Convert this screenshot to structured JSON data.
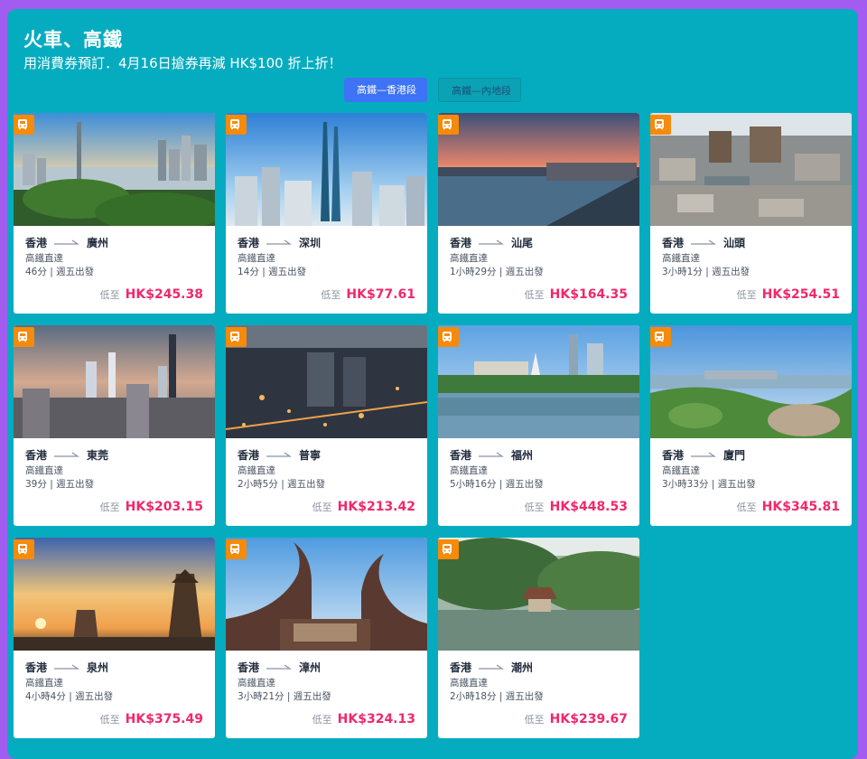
{
  "header": {
    "title": "火車、高鐵",
    "subtitle": "用消費券預訂．4月16日搶券再減 HK$100 折上折！"
  },
  "tabs": [
    {
      "label": "高鐵—香港段",
      "active": true
    },
    {
      "label": "高鐵—內地段",
      "active": false
    }
  ],
  "badge_icon": "train-icon",
  "colors": {
    "accent": "#3e73f5",
    "price": "#f0286d",
    "badge": "#f58a0b",
    "panel": "#05acbf"
  },
  "cards": [
    {
      "from": "香港",
      "to": "廣州",
      "type": "高鐵直達",
      "schedule": "46分 | 週五出發",
      "price_label": "低至",
      "price": "HK$245.38"
    },
    {
      "from": "香港",
      "to": "深圳",
      "type": "高鐵直達",
      "schedule": "14分 | 週五出發",
      "price_label": "低至",
      "price": "HK$77.61"
    },
    {
      "from": "香港",
      "to": "汕尾",
      "type": "高鐵直達",
      "schedule": "1小時29分 | 週五出發",
      "price_label": "低至",
      "price": "HK$164.35"
    },
    {
      "from": "香港",
      "to": "汕頭",
      "type": "高鐵直達",
      "schedule": "3小時1分 | 週五出發",
      "price_label": "低至",
      "price": "HK$254.51"
    },
    {
      "from": "香港",
      "to": "東莞",
      "type": "高鐵直達",
      "schedule": "39分 | 週五出發",
      "price_label": "低至",
      "price": "HK$203.15"
    },
    {
      "from": "香港",
      "to": "普寧",
      "type": "高鐵直達",
      "schedule": "2小時5分 | 週五出發",
      "price_label": "低至",
      "price": "HK$213.42"
    },
    {
      "from": "香港",
      "to": "福州",
      "type": "高鐵直達",
      "schedule": "5小時16分 | 週五出發",
      "price_label": "低至",
      "price": "HK$448.53"
    },
    {
      "from": "香港",
      "to": "廈門",
      "type": "高鐵直達",
      "schedule": "3小時33分 | 週五出發",
      "price_label": "低至",
      "price": "HK$345.81"
    },
    {
      "from": "香港",
      "to": "泉州",
      "type": "高鐵直達",
      "schedule": "4小時4分 | 週五出發",
      "price_label": "低至",
      "price": "HK$375.49"
    },
    {
      "from": "香港",
      "to": "漳州",
      "type": "高鐵直達",
      "schedule": "3小時21分 | 週五出發",
      "price_label": "低至",
      "price": "HK$324.13"
    },
    {
      "from": "香港",
      "to": "潮州",
      "type": "高鐵直達",
      "schedule": "2小時18分 | 週五出發",
      "price_label": "低至",
      "price": "HK$239.67"
    }
  ]
}
